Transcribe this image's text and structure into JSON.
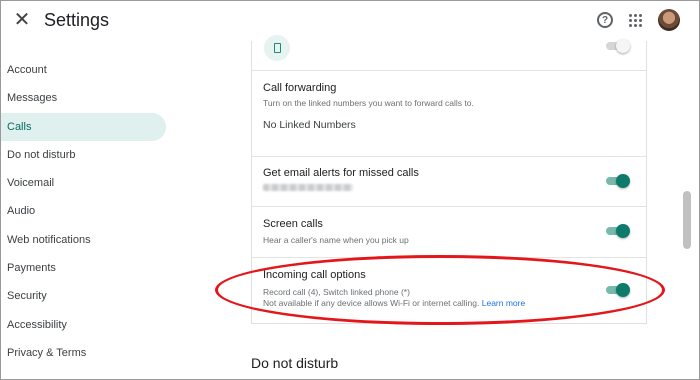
{
  "header": {
    "close_icon": "close-icon",
    "title": "Settings",
    "help_icon": "help-icon",
    "apps_icon": "apps-grid-icon",
    "avatar": "user-avatar"
  },
  "sidebar": {
    "items": [
      {
        "label": "Account"
      },
      {
        "label": "Messages"
      },
      {
        "label": "Calls",
        "active": true
      },
      {
        "label": "Do not disturb"
      },
      {
        "label": "Voicemail"
      },
      {
        "label": "Audio"
      },
      {
        "label": "Web notifications"
      },
      {
        "label": "Payments"
      },
      {
        "label": "Security"
      },
      {
        "label": "Accessibility"
      },
      {
        "label": "Privacy & Terms"
      }
    ]
  },
  "calls": {
    "top_row": {
      "icon": "phone-icon",
      "toggle": "off"
    },
    "call_forwarding": {
      "title": "Call forwarding",
      "subtitle": "Turn on the linked numbers you want to forward calls to.",
      "linked": "No Linked Numbers"
    },
    "email_alerts": {
      "title": "Get email alerts for missed calls",
      "toggle": "on"
    },
    "screen_calls": {
      "title": "Screen calls",
      "subtitle": "Hear a caller's name when you pick up",
      "toggle": "on"
    },
    "incoming_options": {
      "title": "Incoming call options",
      "subtitle": "Record call (4), Switch linked phone (*)",
      "note": "Not available if any device allows Wi-Fi or internet calling.",
      "learn_more": "Learn more",
      "toggle": "on"
    }
  },
  "next_section": {
    "title": "Do not disturb"
  },
  "colors": {
    "accent": "#0e7a6b",
    "active_nav_bg": "#dff0ef",
    "annotation": "#e5161a",
    "link": "#1a73e8"
  }
}
